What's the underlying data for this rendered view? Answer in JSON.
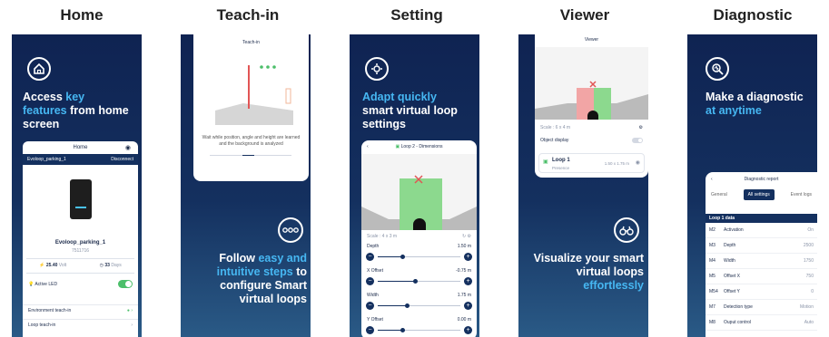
{
  "headers": [
    "Home",
    "Teach-in",
    "Setting",
    "Viewer",
    "Diagnostic"
  ],
  "home": {
    "headline_pre": "Access ",
    "headline_acc": "key features",
    "headline_post": " from home screen",
    "title": "Home",
    "device": "Evoloop_parking_1",
    "status": "Disconnect",
    "device_name": "Evoloop_parking_1",
    "serial": "7511716",
    "volt": "25.40",
    "volt_unit": "Volt",
    "days": "33",
    "days_unit": "Days",
    "led_label": "Active LED",
    "env_label": "Environment teach-in",
    "loop_label": "Loop teach-in"
  },
  "teach": {
    "card_title": "Teach-in",
    "desc": "Wait while position, angle and height are learned and the background is analyzed",
    "headline_pre": "Follow ",
    "headline_acc": "easy and intuitive steps",
    "headline_post": " to configure Smart virtual loops"
  },
  "setting": {
    "headline_acc": "Adapt quickly",
    "headline_post": "smart virtual loop settings",
    "loop_title": "Loop 2 - Dimensions",
    "scale": "Scale : 4 x 3 m",
    "params": [
      {
        "label": "Depth",
        "value": "1.50 m",
        "pos": 0.3
      },
      {
        "label": "X Offset",
        "value": "-0.75 m",
        "pos": 0.45
      },
      {
        "label": "Width",
        "value": "1.75 m",
        "pos": 0.35
      },
      {
        "label": "Y Offset",
        "value": "0.00 m",
        "pos": 0.3
      }
    ]
  },
  "viewer": {
    "card_title": "Viewer",
    "scale": "Scale : 6 x 4 m",
    "object_display": "Object display",
    "loop_name": "Loop 1",
    "loop_status": "Presence",
    "loop_dims": "1.50 x 1.75 m",
    "headline_pre": "Visualize your smart virtual loops ",
    "headline_acc": "effortlessly"
  },
  "diag": {
    "headline_pre": "Make a diagnostic ",
    "headline_acc": "at anytime",
    "report_title": "Diagnostic report",
    "tabs": [
      "General",
      "All settings",
      "Event logs"
    ],
    "section": "Loop 1 data",
    "rows": [
      {
        "code": "M2",
        "label": "Activation",
        "value": "On"
      },
      {
        "code": "M3",
        "label": "Depth",
        "value": "2500"
      },
      {
        "code": "M4",
        "label": "Width",
        "value": "1750"
      },
      {
        "code": "M5",
        "label": "Offset X",
        "value": "750"
      },
      {
        "code": "M54",
        "label": "Offset Y",
        "value": "0"
      },
      {
        "code": "M7",
        "label": "Detection type",
        "value": "Motion"
      },
      {
        "code": "M8",
        "label": "Ouput control",
        "value": "Auto"
      }
    ]
  },
  "colors": {
    "navy": "#14305f",
    "accent": "#46b7f2",
    "green": "#4cbf6a",
    "red": "#e25555"
  }
}
